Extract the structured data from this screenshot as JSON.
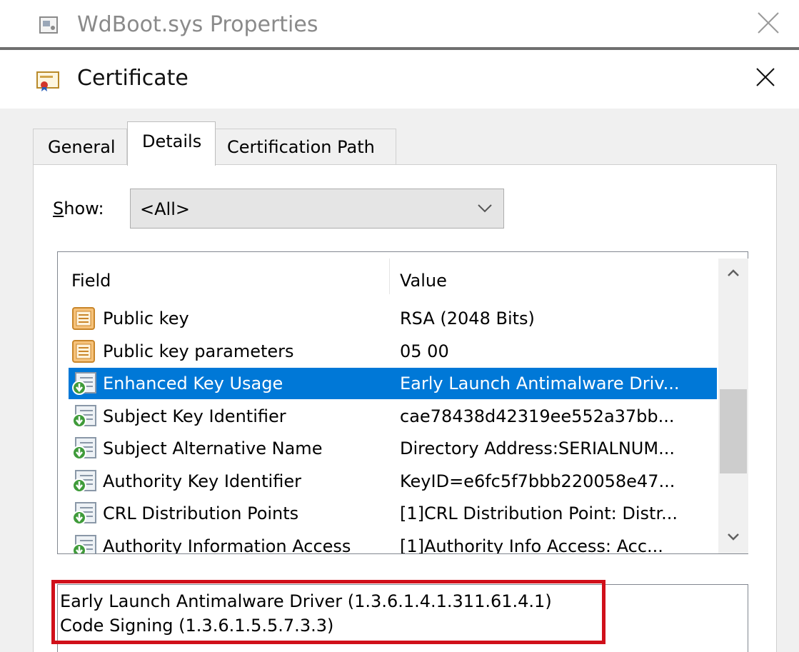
{
  "parent_window": {
    "title": "WdBoot.sys Properties"
  },
  "dialog": {
    "title": "Certificate"
  },
  "tabs": [
    {
      "label": "General",
      "active": false
    },
    {
      "label": "Details",
      "active": true
    },
    {
      "label": "Certification Path",
      "active": false
    }
  ],
  "show": {
    "label_accel": "S",
    "label_rest": "how:",
    "selected": "<All>"
  },
  "list": {
    "columns": {
      "field": "Field",
      "value": "Value"
    },
    "rows": [
      {
        "field": "Public key",
        "value": "RSA (2048 Bits)",
        "icon": "certificate-field-icon",
        "selected": false
      },
      {
        "field": "Public key parameters",
        "value": "05 00",
        "icon": "certificate-field-icon",
        "selected": false
      },
      {
        "field": "Enhanced Key Usage",
        "value": "Early Launch Antimalware Driv...",
        "icon": "certificate-extension-icon",
        "selected": true
      },
      {
        "field": "Subject Key Identifier",
        "value": "cae78438d42319ee552a37bb...",
        "icon": "certificate-extension-icon",
        "selected": false
      },
      {
        "field": "Subject Alternative Name",
        "value": "Directory Address:SERIALNUM...",
        "icon": "certificate-extension-icon",
        "selected": false
      },
      {
        "field": "Authority Key Identifier",
        "value": "KeyID=e6fc5f7bbb220058e47...",
        "icon": "certificate-extension-icon",
        "selected": false
      },
      {
        "field": "CRL Distribution Points",
        "value": "[1]CRL Distribution Point: Distr...",
        "icon": "certificate-extension-icon",
        "selected": false
      },
      {
        "field": "Authority Information Access",
        "value": "[1]Authority Info Access: Acc...",
        "icon": "certificate-extension-icon",
        "selected": false
      }
    ]
  },
  "value_box": {
    "lines": [
      "Early Launch Antimalware Driver (1.3.6.1.4.1.311.61.4.1)",
      "Code Signing (1.3.6.1.5.5.7.3.3)"
    ]
  },
  "colors": {
    "selection": "#0078d7",
    "highlight_box": "#d0101a"
  }
}
